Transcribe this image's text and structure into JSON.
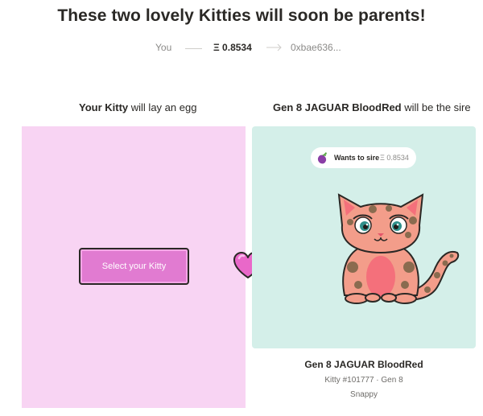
{
  "headline": "These two lovely Kitties will soon be parents!",
  "transaction": {
    "from": "You",
    "price": "Ξ 0.8534",
    "to": "0xbae636..."
  },
  "left": {
    "label_bold": "Your Kitty",
    "label_rest": " will lay an egg",
    "select_button": "Select your Kitty"
  },
  "right": {
    "label_bold": "Gen 8 JAGUAR BloodRed",
    "label_rest": " will be the sire",
    "badge": {
      "icon": "eggplant-icon",
      "label": "Wants to sire",
      "price": "Ξ 0.8534"
    },
    "kitty": {
      "name": "Gen 8 JAGUAR BloodRed",
      "meta": "Kitty #101777 · Gen 8",
      "trait": "Snappy"
    }
  },
  "colors": {
    "left_panel": "#f8d4f3",
    "right_panel": "#d4efe9",
    "button": "#e17bd1",
    "heart": "#e968c9"
  }
}
